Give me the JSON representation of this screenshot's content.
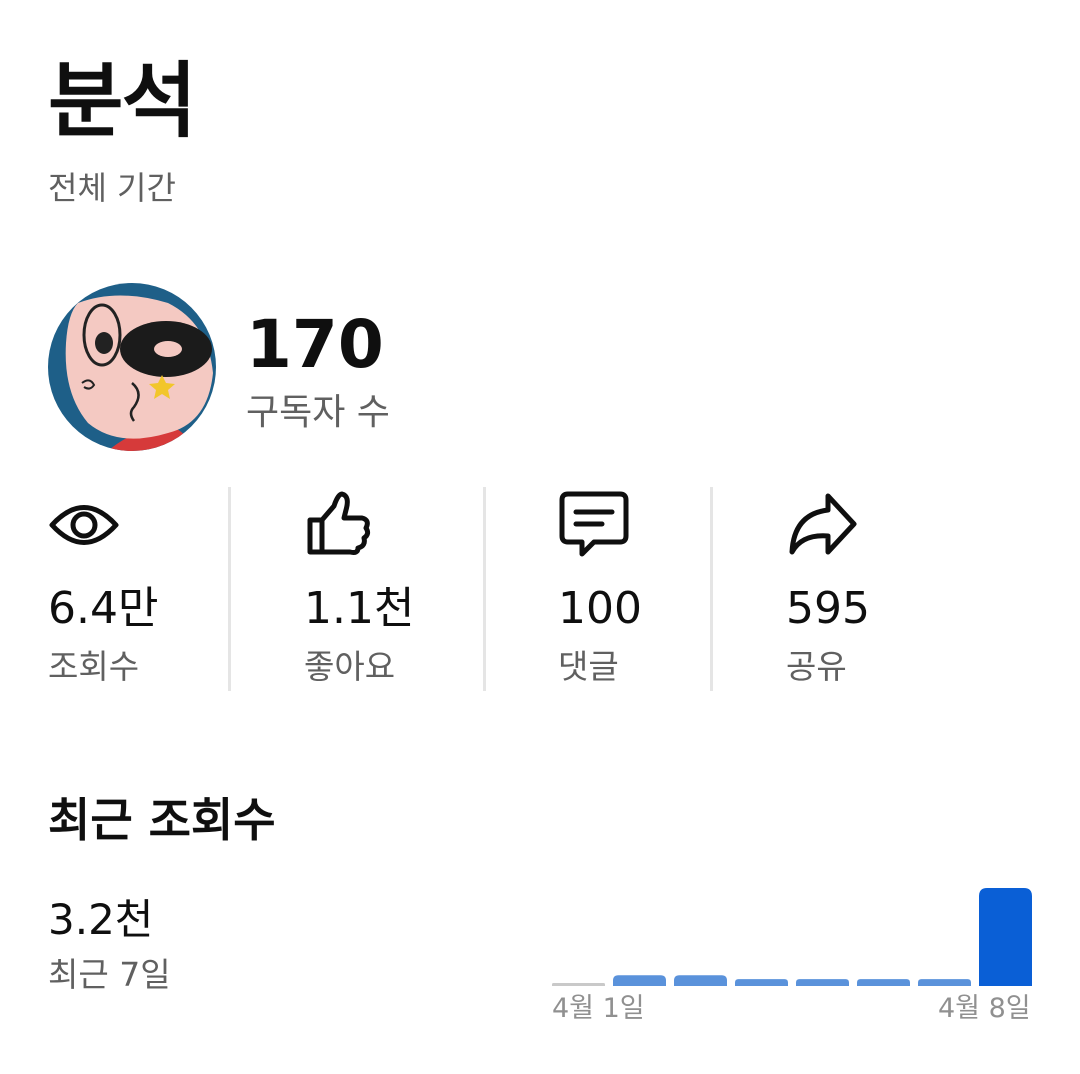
{
  "header": {
    "title": "분석",
    "subtitle": "전체 기간"
  },
  "channel": {
    "subscriber_count": "170",
    "subscriber_label": "구독자 수"
  },
  "stats": [
    {
      "icon": "eye-icon",
      "value": "6.4만",
      "label": "조회수"
    },
    {
      "icon": "thumbs-up-icon",
      "value": "1.1천",
      "label": "좋아요"
    },
    {
      "icon": "comment-icon",
      "value": "100",
      "label": "댓글"
    },
    {
      "icon": "share-icon",
      "value": "595",
      "label": "공유"
    }
  ],
  "recent_views": {
    "title": "최근 조회수",
    "value": "3.2천",
    "period_label": "최근 7일"
  },
  "colors": {
    "bar_today": "#0a5fd6",
    "bar_previous": "#5a92db",
    "bar_baseline": "#c9c9c9"
  },
  "chart_data": {
    "type": "bar",
    "categories": [
      "4월 1일",
      "",
      "",
      "",
      "",
      "",
      "",
      "4월 8일"
    ],
    "values": [
      0,
      0.11,
      0.11,
      0.07,
      0.07,
      0.07,
      0.07,
      1.0
    ],
    "x_tick_labels": [
      "4월 1일",
      "4월 8일"
    ],
    "title": "",
    "xlabel": "",
    "ylabel": "",
    "ylim": [
      0,
      1
    ],
    "grid": false,
    "legend": "none"
  }
}
